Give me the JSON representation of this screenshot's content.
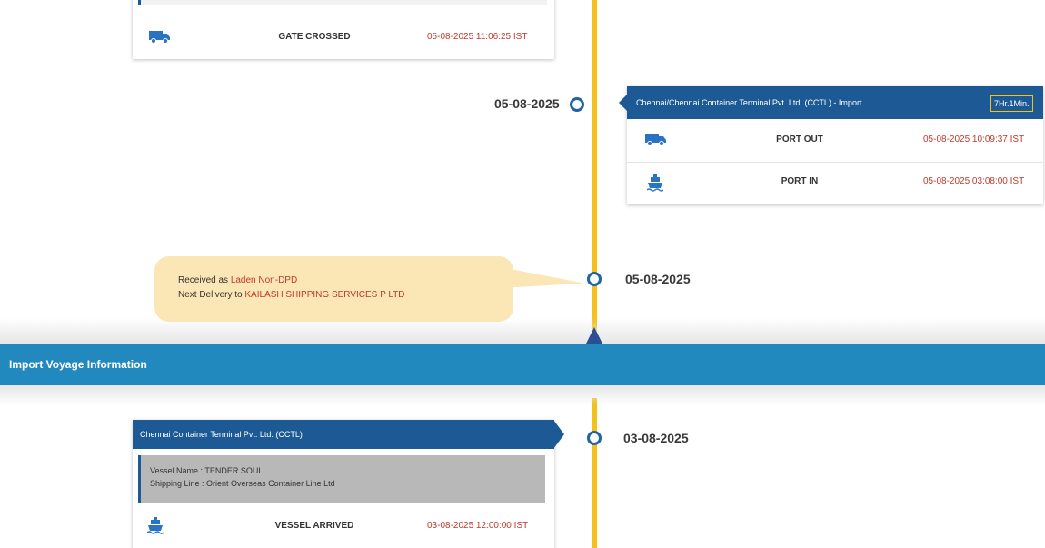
{
  "top_card": {
    "status": "GATE CROSSED",
    "time": "05-08-2025 11:06:25  IST",
    "icon": "truck-icon"
  },
  "event1": {
    "date": "05-08-2025",
    "location": "Chennai/Chennai Container Terminal Pvt. Ltd. (CCTL) - Import",
    "duration": "7Hr.1Min.",
    "rows": [
      {
        "icon": "truck-icon",
        "status": "PORT OUT",
        "time": "05-08-2025 10:09:37  IST"
      },
      {
        "icon": "ship-icon",
        "status": "PORT IN",
        "time": "05-08-2025 03:08:00  IST"
      }
    ]
  },
  "event2": {
    "date": "05-08-2025",
    "line1_prefix": "Received as ",
    "line1_value": "Laden Non-DPD",
    "line2_prefix": "Next Delivery to ",
    "line2_value": "KAILASH SHIPPING SERVICES P LTD"
  },
  "section": {
    "title": "Import Voyage Information"
  },
  "event3": {
    "date": "03-08-2025",
    "location": "Chennai Container Terminal Pvt. Ltd. (CCTL)",
    "vessel_name": "Vessel Name : TENDER SOUL",
    "shipping_line": "Shipping Line : Orient Overseas Container Line Ltd",
    "row": {
      "icon": "ship-icon",
      "status": "VESSEL ARRIVED",
      "time": "03-08-2025 12:00:00  IST"
    }
  },
  "colors": {
    "timeline": "#f4c01a",
    "accent_blue": "#1d5a95",
    "band_blue": "#2289bf",
    "time_red": "#c0392b",
    "bubble": "#fbe6b6"
  }
}
